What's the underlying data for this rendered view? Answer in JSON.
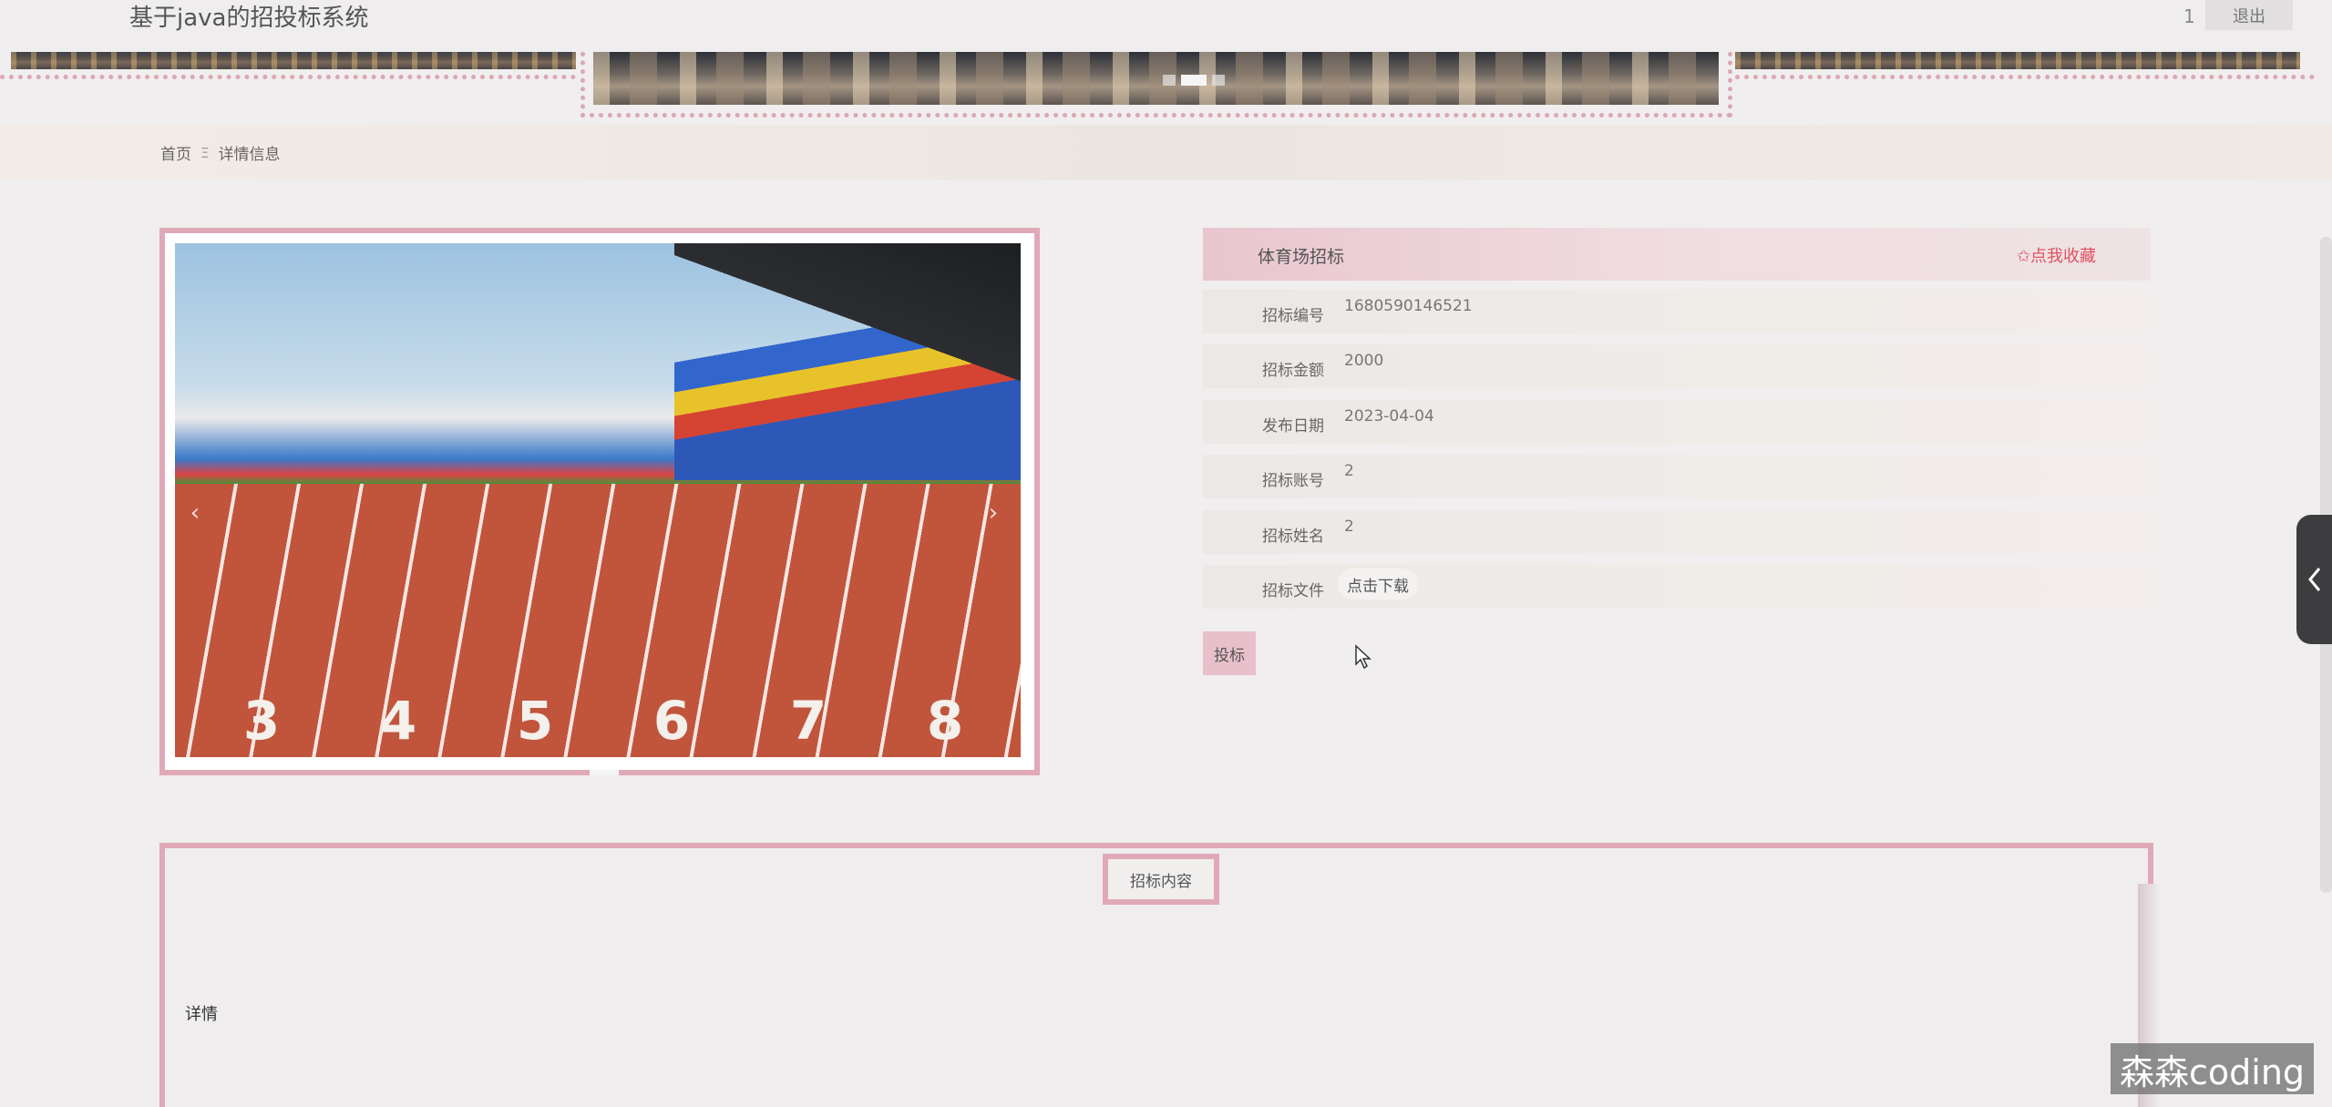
{
  "header": {
    "site_title": "基于java的招投标系统",
    "user_id": "1",
    "logout_label": "退出"
  },
  "breadcrumb": {
    "home": "首页",
    "separator": "Ξ",
    "current": "详情信息"
  },
  "gallery": {
    "lane_numbers": [
      "3",
      "4",
      "5",
      "6",
      "7",
      "8"
    ],
    "prev_icon": "‹",
    "next_icon": "›"
  },
  "detail": {
    "title": "体育场招标",
    "favorite_label": "✩点我收藏",
    "fields": [
      {
        "label": "招标编号",
        "value": "1680590146521"
      },
      {
        "label": "招标金额",
        "value": "2000"
      },
      {
        "label": "发布日期",
        "value": "2023-04-04"
      },
      {
        "label": "招标账号",
        "value": "2"
      },
      {
        "label": "招标姓名",
        "value": "2"
      },
      {
        "label": "招标文件",
        "value": ""
      }
    ],
    "download_label": "点击下载",
    "bid_label": "投标"
  },
  "content": {
    "tab_label": "招标内容",
    "body_text": "详情"
  },
  "watermark": "森森coding",
  "colors": {
    "accent_pink": "#e0a9b8",
    "favorite_red": "#e05060",
    "page_bg": "#f0eeee"
  }
}
